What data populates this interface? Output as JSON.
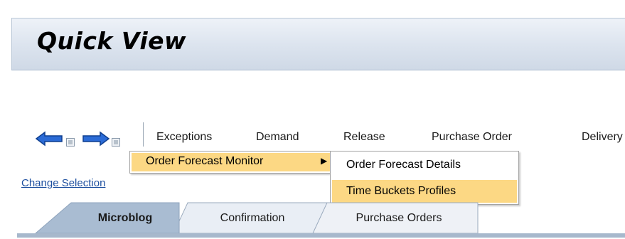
{
  "header": {
    "title": "Quick View"
  },
  "toolbar": {
    "nav_icons": [
      "back-arrow-icon",
      "forward-arrow-icon"
    ],
    "menu": [
      "Exceptions",
      "Demand",
      "Release",
      "Purchase Order",
      "Delivery"
    ]
  },
  "dropdown": {
    "level1": {
      "label": "Order Forecast Monitor",
      "arrow": "▶"
    },
    "level2": [
      "Order Forecast Details",
      "Time Buckets Profiles"
    ]
  },
  "links": {
    "change_selection": "Change Selection"
  },
  "tabs": [
    "Microblog",
    "Confirmation",
    "Purchase Orders"
  ],
  "colors": {
    "accent_highlight": "#fcd884",
    "link": "#1d4f9f",
    "active_tab": "#a9bcd2",
    "arrow_blue": "#2b6bd6"
  }
}
